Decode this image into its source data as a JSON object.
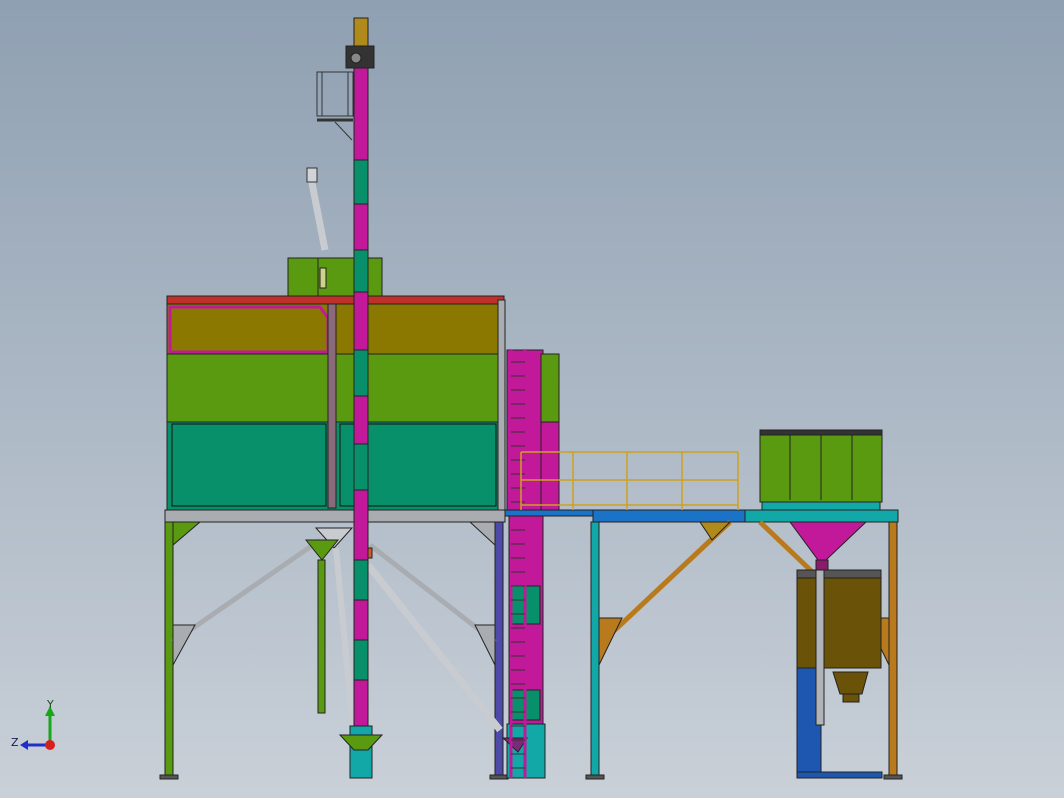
{
  "viewport": {
    "bg_top": "#8fa0b2",
    "bg_bottom": "#c9d0d8"
  },
  "triad": {
    "y_label": "Y",
    "z_label": "Z",
    "y_color": "#1aa61a",
    "z_color": "#1f2fc8",
    "x_color": "#d61f1f"
  },
  "colors": {
    "magenta": "#c2189a",
    "lime": "#5a9a10",
    "teal": "#08906a",
    "olive": "#8a7800",
    "gold": "#b08a1a",
    "orange": "#b87a1c",
    "blue": "#1b73c8",
    "cyan": "#13a8a8",
    "grey": "#a9adb2",
    "purple": "#4d4aa8",
    "darkblue": "#1e57b0",
    "bronze": "#6a5208"
  }
}
